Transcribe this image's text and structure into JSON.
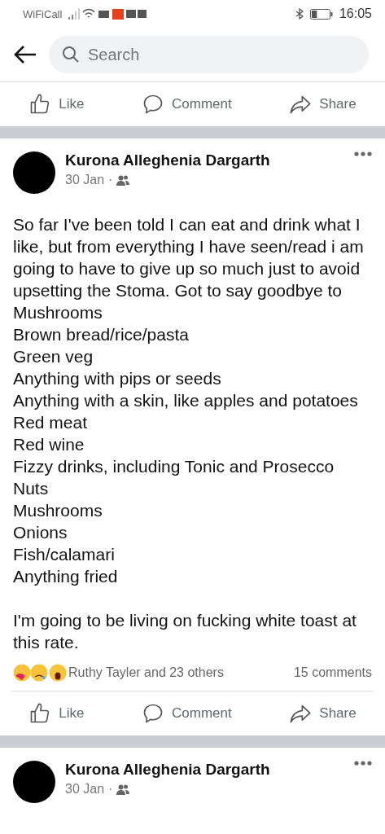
{
  "status_bar": {
    "carrier": "WiFiCall",
    "time": "16:05"
  },
  "search": {
    "placeholder": "Search"
  },
  "top_actions": [
    "Like",
    "Comment",
    "Share"
  ],
  "posts": [
    {
      "author": "Kurona Alleghenia Dargarth",
      "date": "30 Jan",
      "separator": "·",
      "text": "So far I've been told I can eat and drink what I like, but from everything I have seen/read i am going to have to give up so much just to avoid upsetting the Stoma. Got to say goodbye to\nMushrooms\nBrown bread/rice/pasta\nGreen veg\nAnything with pips or seeds\nAnything with a skin, like apples and potatoes\nRed meat\nRed wine\nFizzy drinks, including Tonic and Prosecco\nNuts\nMushrooms\nOnions\nFish/calamari\nAnything fried\n\nI'm going to be living on fucking white toast at this rate.",
      "reactions": "Ruthy Tayler and 23 others",
      "comments": "15 comments",
      "actions": [
        "Like",
        "Comment",
        "Share"
      ]
    },
    {
      "author": "Kurona Alleghenia Dargarth",
      "date": "30 Jan",
      "separator": "·"
    }
  ]
}
